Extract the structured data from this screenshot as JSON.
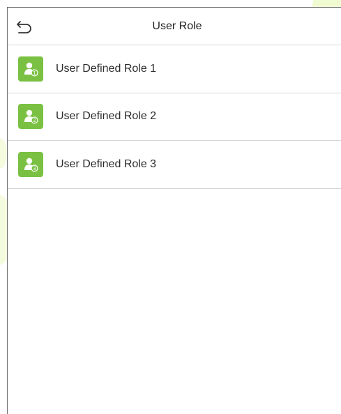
{
  "header": {
    "title": "User Role",
    "back_icon": "back-arrow-icon"
  },
  "roles": [
    {
      "label": "User Defined Role 1",
      "number": "1",
      "icon": "user-role-icon"
    },
    {
      "label": "User Defined Role 2",
      "number": "2",
      "icon": "user-role-icon"
    },
    {
      "label": "User Defined Role 3",
      "number": "3",
      "icon": "user-role-icon"
    }
  ],
  "colors": {
    "icon_background": "#7ac143",
    "divider": "#d6d6d6",
    "watermark": "#eaf7c6"
  }
}
